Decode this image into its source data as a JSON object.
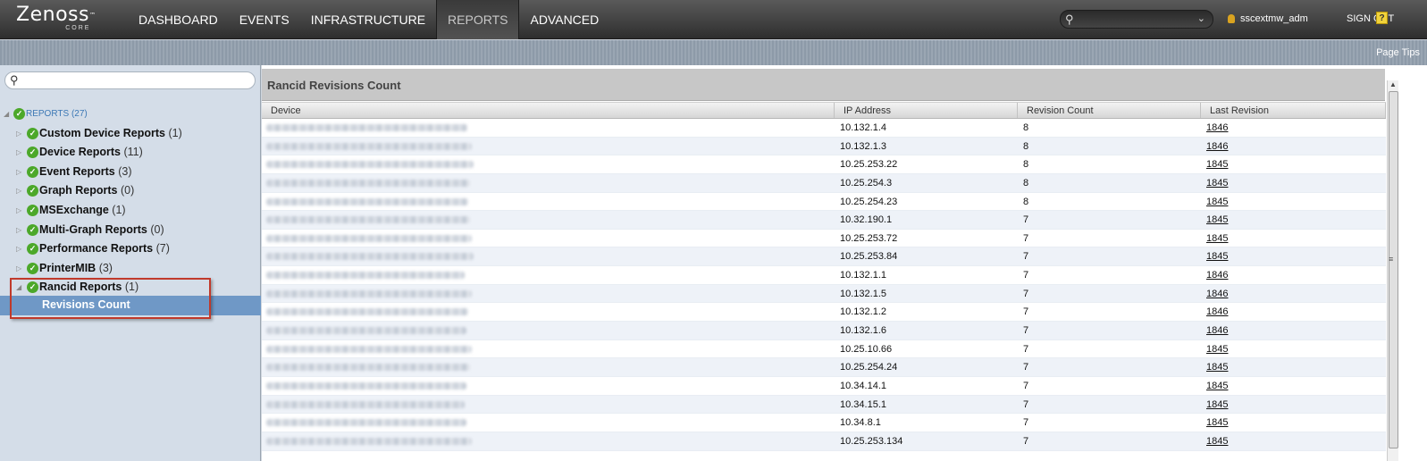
{
  "brand": {
    "name": "Zen",
    "name_o": "o",
    "name_rest": "ss",
    "tm": "™",
    "edition": "CORE"
  },
  "nav": [
    {
      "label": "DASHBOARD"
    },
    {
      "label": "EVENTS"
    },
    {
      "label": "INFRASTRUCTURE"
    },
    {
      "label": "REPORTS"
    },
    {
      "label": "ADVANCED"
    }
  ],
  "header": {
    "username": "sscextmw_adm",
    "signout": "SIGN OUT",
    "help": "?"
  },
  "subbar": {
    "page_tips": "Page Tips"
  },
  "tree": {
    "root": {
      "label": "REPORTS",
      "count": "(27)"
    },
    "items": [
      {
        "label": "Custom Device Reports",
        "count": "(1)"
      },
      {
        "label": "Device Reports",
        "count": "(11)"
      },
      {
        "label": "Event Reports",
        "count": "(3)"
      },
      {
        "label": "Graph Reports",
        "count": "(0)"
      },
      {
        "label": "MSExchange",
        "count": "(1)"
      },
      {
        "label": "Multi-Graph Reports",
        "count": "(0)"
      },
      {
        "label": "Performance Reports",
        "count": "(7)"
      },
      {
        "label": "PrinterMIB",
        "count": "(3)"
      },
      {
        "label": "Rancid Reports",
        "count": "(1)"
      }
    ],
    "selected_child": "Revisions Count"
  },
  "report": {
    "title": "Rancid Revisions Count",
    "columns": {
      "device": "Device",
      "ip": "IP Address",
      "revcount": "Revision Count",
      "last": "Last Revision"
    },
    "rows": [
      {
        "ip": "10.132.1.4",
        "count": "8",
        "last": "1846"
      },
      {
        "ip": "10.132.1.3",
        "count": "8",
        "last": "1846"
      },
      {
        "ip": "10.25.253.22",
        "count": "8",
        "last": "1845"
      },
      {
        "ip": "10.25.254.3",
        "count": "8",
        "last": "1845"
      },
      {
        "ip": "10.25.254.23",
        "count": "8",
        "last": "1845"
      },
      {
        "ip": "10.32.190.1",
        "count": "7",
        "last": "1845"
      },
      {
        "ip": "10.25.253.72",
        "count": "7",
        "last": "1845"
      },
      {
        "ip": "10.25.253.84",
        "count": "7",
        "last": "1845"
      },
      {
        "ip": "10.132.1.1",
        "count": "7",
        "last": "1846"
      },
      {
        "ip": "10.132.1.5",
        "count": "7",
        "last": "1846"
      },
      {
        "ip": "10.132.1.2",
        "count": "7",
        "last": "1846"
      },
      {
        "ip": "10.132.1.6",
        "count": "7",
        "last": "1846"
      },
      {
        "ip": "10.25.10.66",
        "count": "7",
        "last": "1845"
      },
      {
        "ip": "10.25.254.24",
        "count": "7",
        "last": "1845"
      },
      {
        "ip": "10.34.14.1",
        "count": "7",
        "last": "1845"
      },
      {
        "ip": "10.34.15.1",
        "count": "7",
        "last": "1845"
      },
      {
        "ip": "10.34.8.1",
        "count": "7",
        "last": "1845"
      },
      {
        "ip": "10.25.253.134",
        "count": "7",
        "last": "1845"
      }
    ]
  }
}
